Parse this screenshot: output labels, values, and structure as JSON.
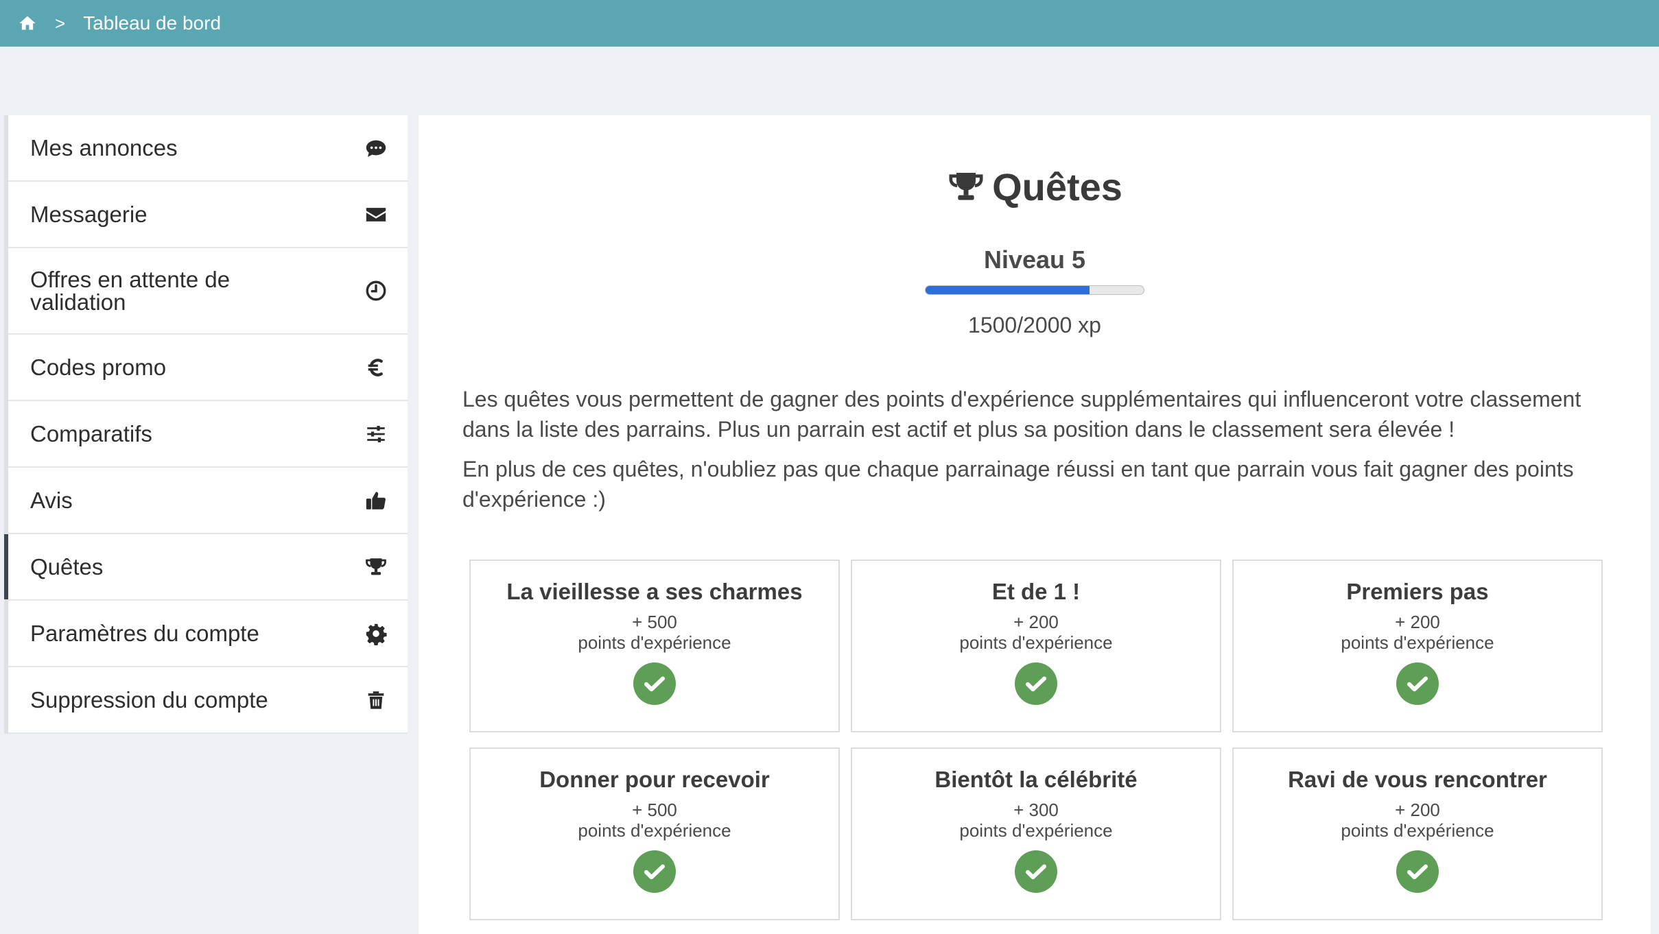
{
  "topbar": {
    "home_icon": "home-icon",
    "separator": ">",
    "breadcrumb": "Tableau de bord"
  },
  "sidebar": {
    "items": [
      {
        "label": "Mes annonces",
        "icon": "comments-icon"
      },
      {
        "label": "Messagerie",
        "icon": "envelope-icon"
      },
      {
        "label": "Offres en attente de validation",
        "icon": "clock-icon"
      },
      {
        "label": "Codes promo",
        "icon": "euro-icon"
      },
      {
        "label": "Comparatifs",
        "icon": "sliders-icon"
      },
      {
        "label": "Avis",
        "icon": "thumbs-up-icon"
      },
      {
        "label": "Quêtes",
        "icon": "trophy-icon",
        "active": true
      },
      {
        "label": "Paramètres du compte",
        "icon": "gear-icon"
      },
      {
        "label": "Suppression du compte",
        "icon": "trash-icon"
      }
    ]
  },
  "main": {
    "title": "Quêtes",
    "level": "Niveau 5",
    "xp_text": "1500/2000 xp",
    "progress": 0.75,
    "intro": [
      "Les quêtes vous permettent de gagner des points d'expérience supplémentaires qui influenceront votre classement dans la liste des parrains. Plus un parrain est actif et plus sa position dans le classement sera élevée !",
      "En plus de ces quêtes, n'oubliez pas que chaque parrainage réussi en tant que parrain vous fait gagner des points d'expérience :)"
    ],
    "quests": [
      {
        "title": "La vieillesse a ses charmes",
        "points": "+ 500",
        "unit": "points d'expérience",
        "completed": true
      },
      {
        "title": "Et de 1 !",
        "points": "+ 200",
        "unit": "points d'expérience",
        "completed": true
      },
      {
        "title": "Premiers pas",
        "points": "+ 200",
        "unit": "points d'expérience",
        "completed": true
      },
      {
        "title": "Donner pour recevoir",
        "points": "+ 500",
        "unit": "points d'expérience",
        "completed": true
      },
      {
        "title": "Bientôt la célébrité",
        "points": "+ 300",
        "unit": "points d'expérience",
        "completed": true
      },
      {
        "title": "Ravi de vous rencontrer",
        "points": "+ 200",
        "unit": "points d'expérience",
        "completed": true
      }
    ]
  },
  "colors": {
    "topbar": "#5ba6b3",
    "progress": "#2d6fd8",
    "check": "#5e9e57",
    "background": "#edf0f4"
  }
}
